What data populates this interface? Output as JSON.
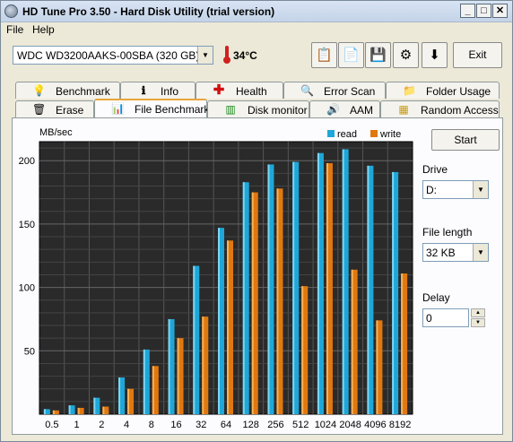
{
  "window": {
    "title": "HD Tune Pro 3.50 - Hard Disk Utility (trial version)"
  },
  "menu": {
    "file": "File",
    "help": "Help"
  },
  "toolbar": {
    "drive": "WDC WD3200AAKS-00SBA (320 GB)",
    "temperature": "34°C",
    "exit_label": "Exit"
  },
  "tabs_row1": [
    {
      "label": "Benchmark",
      "icon": "lightbulb-icon"
    },
    {
      "label": "Info",
      "icon": "info-icon"
    },
    {
      "label": "Health",
      "icon": "health-cross-icon"
    },
    {
      "label": "Error Scan",
      "icon": "magnifier-icon"
    },
    {
      "label": "Folder Usage",
      "icon": "folder-icon"
    }
  ],
  "tabs_row2": [
    {
      "label": "Erase",
      "icon": "trash-icon"
    },
    {
      "label": "File Benchmark",
      "icon": "file-benchmark-icon"
    },
    {
      "label": "Disk monitor",
      "icon": "disk-monitor-icon"
    },
    {
      "label": "AAM",
      "icon": "speaker-icon"
    },
    {
      "label": "Random Access",
      "icon": "random-access-icon"
    }
  ],
  "side": {
    "start_label": "Start",
    "drive_label": "Drive",
    "drive_value": "D:",
    "file_length_label": "File length",
    "file_length_value": "32 KB",
    "delay_label": "Delay",
    "delay_value": "0"
  },
  "colors": {
    "read": "#1ea7d8",
    "write": "#e07810",
    "plot_bg": "#2a2a2a"
  },
  "chart_data": {
    "type": "bar",
    "ylabel": "MB/sec",
    "ylim": [
      0,
      215
    ],
    "yticks": [
      50,
      100,
      150,
      200
    ],
    "categories": [
      "0.5",
      "1",
      "2",
      "4",
      "8",
      "16",
      "32",
      "64",
      "128",
      "256",
      "512",
      "1024",
      "2048",
      "4096",
      "8192"
    ],
    "series": [
      {
        "name": "read",
        "values": [
          4,
          7,
          13,
          29,
          51,
          75,
          117,
          147,
          183,
          197,
          199,
          206,
          209,
          196,
          191
        ]
      },
      {
        "name": "write",
        "values": [
          3,
          5,
          6,
          20,
          38,
          60,
          77,
          137,
          175,
          178,
          101,
          198,
          114,
          74,
          111
        ]
      }
    ],
    "legend": "top-right",
    "grid": true
  }
}
